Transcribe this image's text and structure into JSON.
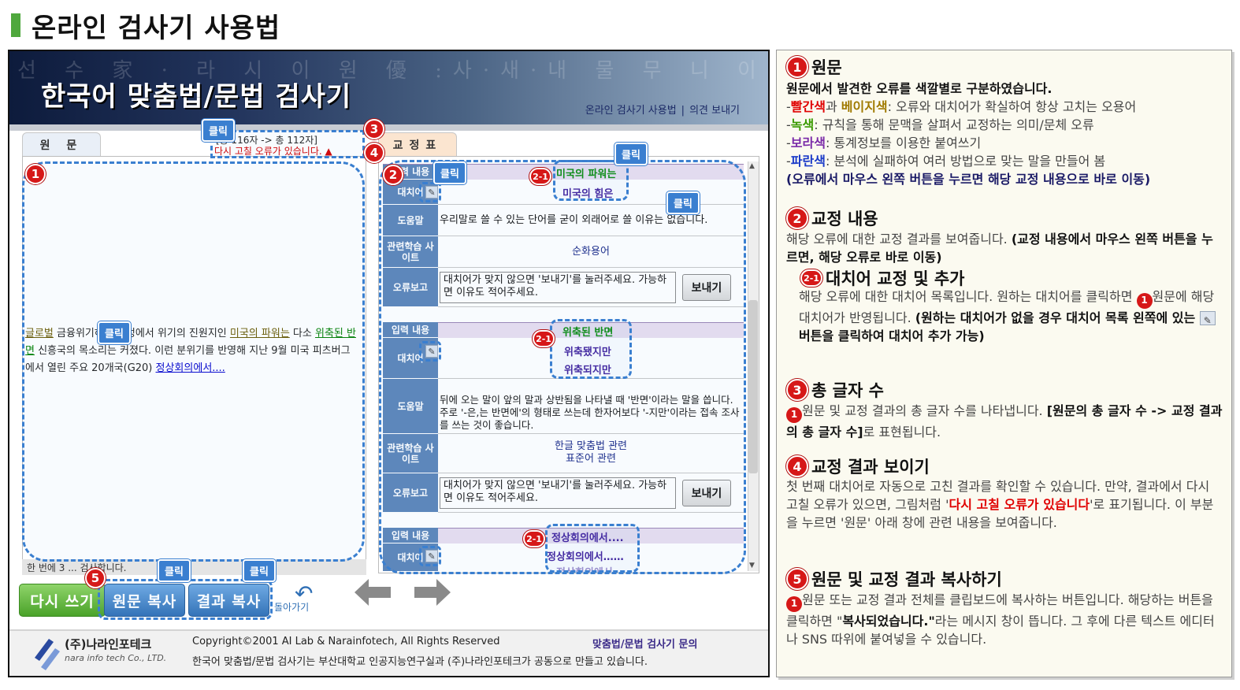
{
  "page_title": "온라인 검사기 사용법",
  "app": {
    "title": "한국어 맞춤법/문법 검사기",
    "banner_glyphs": "선 수 家 · 라 시 이 원 優 :사·새·내 물 무 니 이 文 나",
    "links": [
      "온라인 검사기 사용법",
      "의견 보내기"
    ],
    "tabs": {
      "original": "원 문",
      "correction": "교정표"
    },
    "char_count": "[총 116자 -> 총 112자]",
    "recheck_message": "다시 고칠 오류가 있습니다. ▲",
    "original_text": {
      "p1": "글로벌",
      "p2": " 금융위기",
      "p3": "하는 과정에서 위기의 진원지인 ",
      "p4": "미국의 파워는",
      "p5": " 다소 ",
      "p6": "위축된 반면",
      "p7": " 신흥국의 목소리는 커졌다. 이런 분위기를 반영해 지난 9월 미국 피츠버그에서 열린 주요 20개국(G20) ",
      "p8": "정상회의에서...."
    },
    "original_footer": "한 번에 3 ... 검사합니다.",
    "entries": [
      {
        "head_label": "입력 내용",
        "input": "미국의 파워는",
        "sub_label": "대치어",
        "suggestions": [
          "미국의 힘은"
        ],
        "help_label": "도움말",
        "help": "우리말로 쓸 수 있는 단어를 굳이 외래어로 쓸 이유는 없습니다.",
        "site_label": "관련학습 사이트",
        "sites": [
          "순화용어"
        ],
        "report_label": "오류보고",
        "report": "대치어가 맞지 않으면 '보내기'를 눌러주세요. 가능하면 이유도 적어주세요.",
        "send": "보내기"
      },
      {
        "head_label": "입력 내용",
        "input": "위축된 반면",
        "sub_label": "대치어",
        "suggestions": [
          "위축됐지만",
          "위축되지만"
        ],
        "help_label": "도움말",
        "help": "뒤에 오는 말이 앞의 말과 상반됨을 나타낼 때 '반면'이라는 말을 씁니다. 주로 '-은,는 반면에'의 형태로 쓰는데 한자어보다 '-지만'이라는 접속 조사를 쓰는 것이 좋습니다.",
        "site_label": "관련학습 사이트",
        "sites": [
          "한글 맞춤법 관련",
          "표준어 관련"
        ],
        "report_label": "오류보고",
        "report": "대치어가 맞지 않으면 '보내기'를 눌러주세요. 가능하면 이유도 적어주세요.",
        "send": "보내기"
      },
      {
        "head_label": "입력 내용",
        "input": "정상회의에서....",
        "sub_label": "대치어",
        "suggestions": [
          "정상회의에서……",
          "정상회의에서"
        ]
      }
    ],
    "buttons": {
      "rewrite": "다시 쓰기",
      "copy_original": "원문 복사",
      "copy_result": "결과 복사",
      "back": "돌아가기"
    },
    "footer": {
      "logo": "(주)나라인포테크",
      "logo_sub": "nara info tech Co., LTD.",
      "copyright": "Copyright©2001 AI Lab & Narainfotech, All Rights Reserved",
      "credits": "한국어 맞춤법/문법 검사기는 부산대학교 인공지능연구실과 (주)나라인포테크가 공동으로 만들고 있습니다.",
      "inquiry": "맞춤법/문법 검사기 문의"
    }
  },
  "annotations": {
    "click": "클릭",
    "n1": "1",
    "n2": "2",
    "n3": "3",
    "n4": "4",
    "n5": "5",
    "n21": "2-1"
  },
  "guide": {
    "s1": {
      "title": "원문",
      "line1": "원문에서 발견한 오류를 색깔별로 구분하였습니다.",
      "red": "빨간색",
      "and": "과 ",
      "beige": "베이지색",
      "red_desc": ": 오류와 대치어가 확실하여 항상 고치는 오용어",
      "green": "녹색",
      "green_desc": ": 규칙을 통해 문맥을 살펴서 교정하는 의미/문체 오류",
      "purple": "보라색",
      "purple_desc": ": 통계정보를 이용한 붙여쓰기",
      "blue": "파란색",
      "blue_desc": ": 분석에 실패하여 여러 방법으로 맞는 말을 만들어 봄",
      "note": "(오류에서 마우스 왼쪽 버튼을 누르면 해당 교정 내용으로 바로 이동)"
    },
    "s2": {
      "title": "교정 내용",
      "text_a": "해당 오류에 대한 교정 결과를 보여줍니다. ",
      "text_b": "(교정 내용에서 마우스 왼쪽 버튼을 누르면, 해당 오류로 바로 이동)"
    },
    "s21": {
      "title": "대치어 교정 및 추가",
      "text_a": "해당 오류에 대한 대치어 목록입니다. 원하는 대치어를 클릭하면 ",
      "text_b": "원문에 해당 대치어가 반영됩니다. ",
      "text_c": "(원하는 대치어가 없을 경우 대치어 목록 왼쪽에 있는 ",
      "text_d": "버튼을 클릭하여 대치어 추가 가능)"
    },
    "s3": {
      "title": "총 글자 수",
      "text_a": "원문 및 교정 결과의 총 글자 수를 나타냅니다. ",
      "text_b": "[원문의 총 글자 수 -> 교정 결과의 총 글자 수]",
      "text_c": "로 표현됩니다."
    },
    "s4": {
      "title": "교정 결과 보이기",
      "text_a": "첫 번째 대치어로 자동으로 고친 결과를 확인할 수 있습니다. 만약, 결과에서 다시 고칠 오류가 있으면, 그림처럼 '",
      "highlight": "다시 고칠 오류가 있습니다",
      "text_b": "'로 표기됩니다. 이 부분을 누르면 '원문' 아래 창에 관련 내용을 보여줍니다."
    },
    "s5": {
      "title": "원문 및 교정 결과 복사하기",
      "text_a": "원문 또는 교정 결과 전체를 클립보드에 복사하는 버튼입니다. 해당하는 버튼을 클릭하면 \"",
      "highlight": "복사되었습니다.\"",
      "text_b": "라는 메시지 창이 뜹니다. 그 후에 다른 텍스트 에디터나 SNS 따위에 붙여넣을 수 있습니다."
    }
  }
}
